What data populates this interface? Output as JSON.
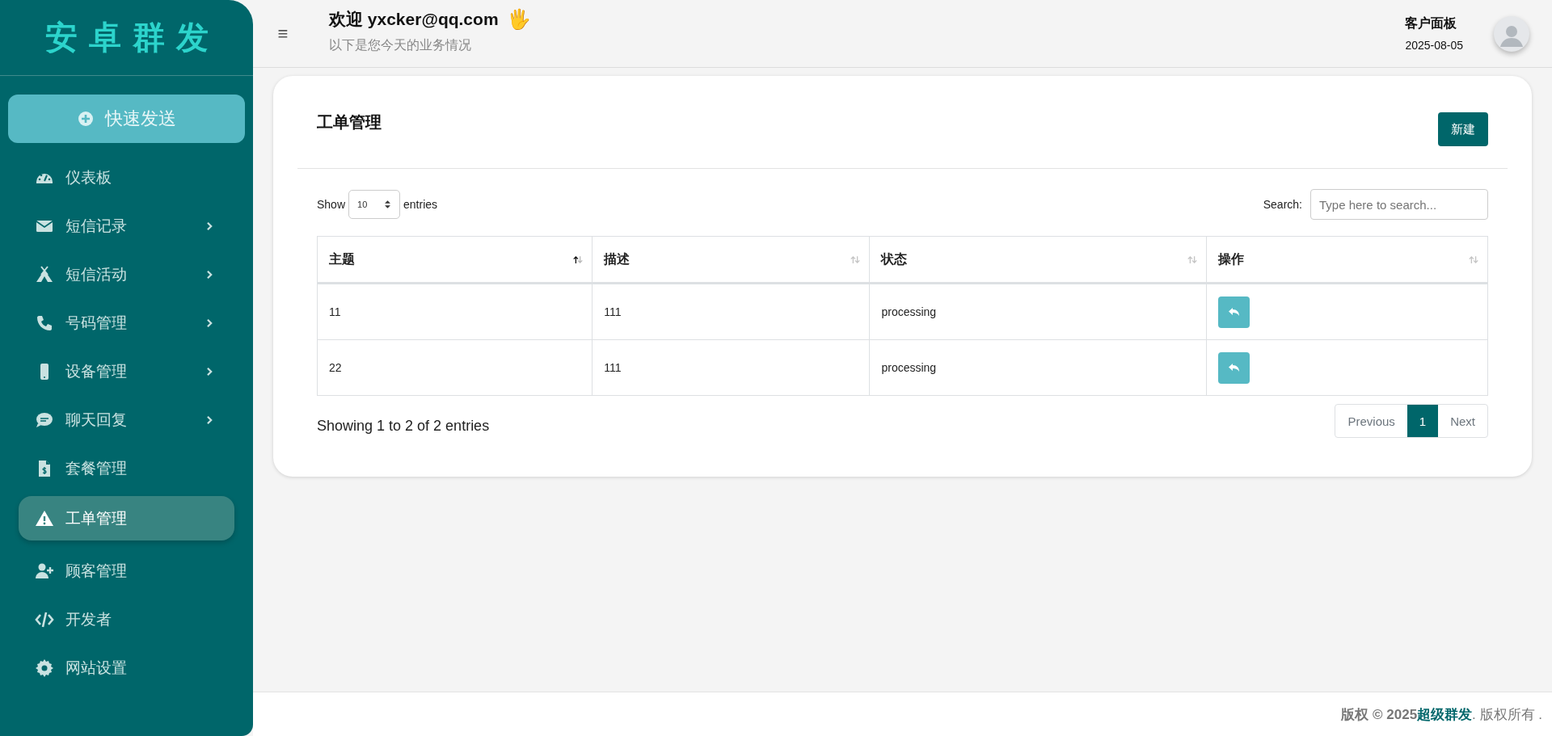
{
  "sidebar": {
    "logo": "安卓群发",
    "quick_button": "快速发送",
    "items": [
      {
        "kind": "dashboard",
        "label": "仪表板",
        "expandable": false,
        "selected": false
      },
      {
        "kind": "envelope",
        "label": "短信记录",
        "expandable": true,
        "selected": false
      },
      {
        "kind": "campground",
        "label": "短信活动",
        "expandable": true,
        "selected": false
      },
      {
        "kind": "phone",
        "label": "号码管理",
        "expandable": true,
        "selected": false
      },
      {
        "kind": "mobile",
        "label": "设备管理",
        "expandable": true,
        "selected": false
      },
      {
        "kind": "sms",
        "label": "聊天回复",
        "expandable": true,
        "selected": false
      },
      {
        "kind": "invoice",
        "label": "套餐管理",
        "expandable": false,
        "selected": false
      },
      {
        "kind": "warning",
        "label": "工单管理",
        "expandable": false,
        "selected": true
      },
      {
        "kind": "user-plus",
        "label": "顾客管理",
        "expandable": false,
        "selected": false
      },
      {
        "kind": "code",
        "label": "开发者",
        "expandable": false,
        "selected": false
      },
      {
        "kind": "gear",
        "label": "网站设置",
        "expandable": false,
        "selected": false
      }
    ]
  },
  "header": {
    "menu_icon": "≡",
    "greeting": "欢迎 yxcker@qq.com",
    "wave": "🖐",
    "subtitle": "以下是您今天的业务情况",
    "panel_title": "客户面板",
    "date": "2025-08-05"
  },
  "card": {
    "title": "工单管理",
    "new_button": "新建",
    "length": {
      "before": "Show",
      "value": "10",
      "after": "entries"
    },
    "search": {
      "label": "Search:",
      "placeholder": "Type here to search..."
    },
    "table": {
      "columns": [
        {
          "label": "主题",
          "sorted": true
        },
        {
          "label": "描述",
          "sorted": false
        },
        {
          "label": "状态",
          "sorted": false
        },
        {
          "label": "操作",
          "sorted": false
        }
      ],
      "rows": [
        {
          "cells": [
            "11",
            "111",
            "processing"
          ]
        },
        {
          "cells": [
            "22",
            "111",
            "processing"
          ]
        }
      ]
    },
    "info": "Showing 1 to 2 of 2 entries",
    "pagination": {
      "previous": "Previous",
      "pages": [
        {
          "label": "1",
          "selected": true
        }
      ],
      "next": "Next"
    }
  },
  "footer": {
    "prefix": "版权 © 2025",
    "brand": "超级群发",
    "suffix": ". 版权所有 ."
  }
}
